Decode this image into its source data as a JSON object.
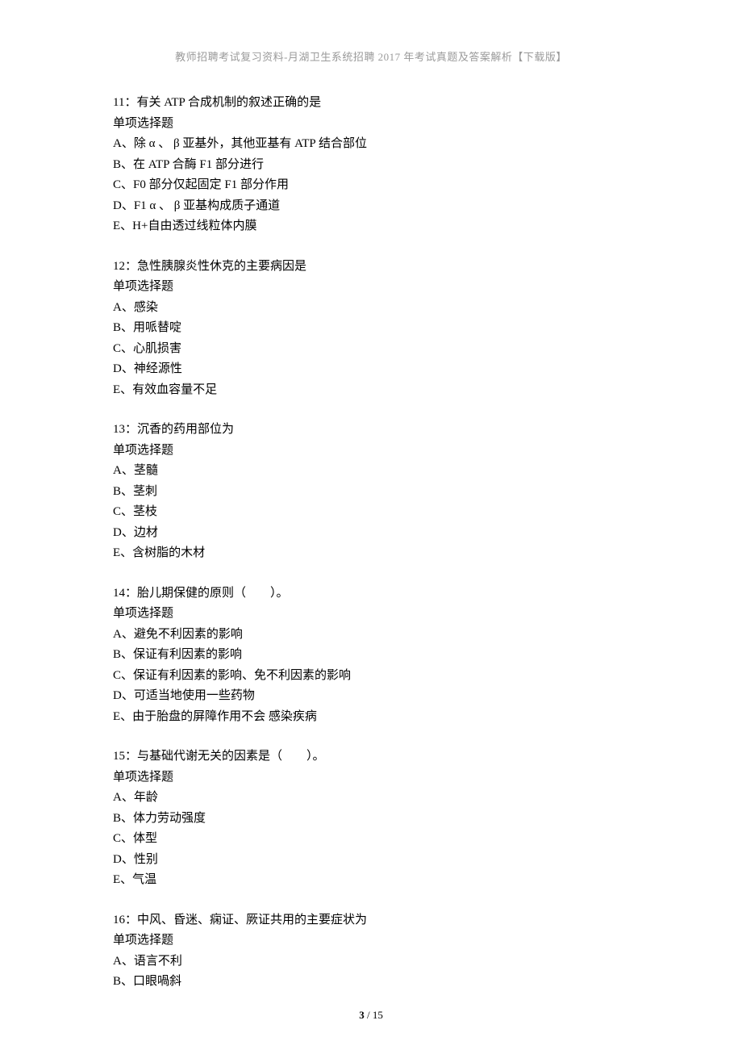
{
  "header": "教师招聘考试复习资料-月湖卫生系统招聘 2017 年考试真题及答案解析【下载版】",
  "questions": [
    {
      "title": "11：有关 ATP 合成机制的叙述正确的是",
      "type": "单项选择题",
      "options": [
        "A、除 α 、 β 亚基外，其他亚基有 ATP 结合部位",
        "B、在 ATP 合酶 F1 部分进行",
        "C、F0 部分仅起固定 F1 部分作用",
        "D、F1 α 、 β 亚基构成质子通道",
        "E、H+自由透过线粒体内膜"
      ]
    },
    {
      "title": "12：急性胰腺炎性休克的主要病因是",
      "type": "单项选择题",
      "options": [
        "A、感染",
        "B、用哌替啶",
        "C、心肌损害",
        "D、神经源性",
        "E、有效血容量不足"
      ]
    },
    {
      "title": "13：沉香的药用部位为",
      "type": "单项选择题",
      "options": [
        "A、茎髓",
        "B、茎刺",
        "C、茎枝",
        "D、边材",
        "E、含树脂的木材"
      ]
    },
    {
      "title": "14：胎儿期保健的原则（　　）。",
      "type": "单项选择题",
      "options": [
        "A、避免不利因素的影响",
        "B、保证有利因素的影响",
        "C、保证有利因素的影响、免不利因素的影响",
        "D、可适当地使用一些药物",
        "E、由于胎盘的屏障作用不会 感染疾病"
      ]
    },
    {
      "title": "15：与基础代谢无关的因素是（　　）。",
      "type": "单项选择题",
      "options": [
        "A、年龄",
        "B、体力劳动强度",
        "C、体型",
        "D、性别",
        "E、气温"
      ]
    },
    {
      "title": "16：中风、昏迷、痫证、厥证共用的主要症状为",
      "type": "单项选择题",
      "options": [
        "A、语言不利",
        "B、口眼喎斜"
      ]
    }
  ],
  "footer": {
    "current": "3",
    "sep": " / ",
    "total": "15"
  }
}
